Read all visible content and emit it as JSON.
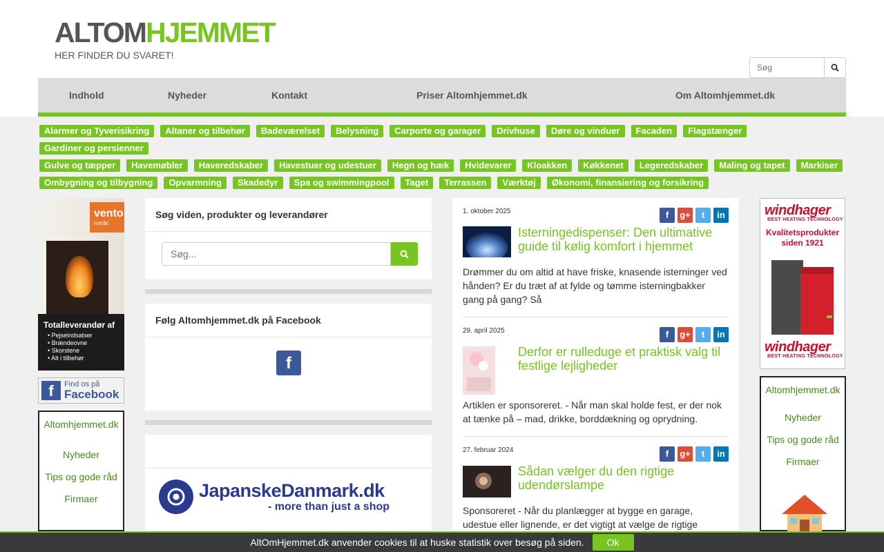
{
  "header": {
    "logo_part1": "ALTOM",
    "logo_part2": "HJEMMET",
    "tagline": "HER FINDER DU SVARET!",
    "search_placeholder": "Søg"
  },
  "nav": {
    "items": [
      "Indhold",
      "Nyheder",
      "Kontakt",
      "Priser Altomhjemmet.dk",
      "Om Altomhjemmet.dk"
    ]
  },
  "tags": {
    "row1": [
      "Alarmer og Tyverisikring",
      "Altaner og tilbehør",
      "Badeværelset",
      "Belysning",
      "Carporte og garager",
      "Drivhuse",
      "Døre og vinduer",
      "Facaden",
      "Flagstænger",
      "Gardiner og persienner"
    ],
    "row2": [
      "Gulve og tæpper",
      "Havemøbler",
      "Haveredskaber",
      "Havestuer og udestuer",
      "Hegn og hæk",
      "Hvidevarer",
      "Kloakken",
      "Køkkenet",
      "Legeredskaber",
      "Maling og tapet",
      "Markiser"
    ],
    "row3": [
      "Ombygning og tilbygning",
      "Opvarmning",
      "Skadedyr",
      "Spa og swimmingpool",
      "Taget",
      "Terrassen",
      "Værktøj",
      "Økonomi, finansiering og forsikring"
    ]
  },
  "left_ad": {
    "brand": "vento",
    "brand_sub": "nordic",
    "heading": "Totalleverandør af",
    "bullets": [
      "• Pejseindsatser",
      "• Brændeovne",
      "• Skorstene",
      "• Alt i tilbehør"
    ]
  },
  "facebook_badge": {
    "line1": "Find os på",
    "line2": "Facebook"
  },
  "small_ad": {
    "title": "Altomhjemmet.dk",
    "links": [
      "Nyheder",
      "Tips og gode råd",
      "Firmaer"
    ]
  },
  "search_panel": {
    "title": "Søg viden, produkter og leverandører",
    "placeholder": "Søg..."
  },
  "facebook_panel": {
    "title": "Følg Altomhjemmet.dk på Facebook"
  },
  "japan_ad": {
    "name": "JapanskeDanmark.dk",
    "slogan": "- more than just a shop"
  },
  "articles": [
    {
      "date": "1. oktober 2025",
      "title": "Isterningedispenser: Den ultimative guide til kølig komfort i hjemmet",
      "desc": "Drømmer du om altid at have friske, knasende isterninger ved hånden? Er du træt af at fylde og tømme isterningbakker gang på gang? Så"
    },
    {
      "date": "29. april 2025",
      "title": "Derfor er rulleduge et praktisk valg til festlige lejligheder",
      "desc": "Artiklen er sponsoreret. - Når man skal holde fest, er der nok at tænke på – mad, drikke, borddækning og oprydning."
    },
    {
      "date": "27. februar 2024",
      "title": "Sådan vælger du den rigtige udendørslampe",
      "desc": "Sponsoreret - Når du planlægger at bygge en garage, udestue eller lignende, er det vigtigt at vælge de rigtige"
    }
  ],
  "right_ad": {
    "logo": "windhager",
    "sub": "BEST HEATING TECHNOLOGY",
    "tagline_line1": "Kvalitetsprodukter",
    "tagline_line2": "siden 1921"
  },
  "cookie": {
    "message": "AltOmHjemmet.dk anvender cookies til at huske statistik over besøg på siden.",
    "ok": "Ok"
  },
  "colors": {
    "accent": "#76c520",
    "facebook": "#3b5998"
  }
}
